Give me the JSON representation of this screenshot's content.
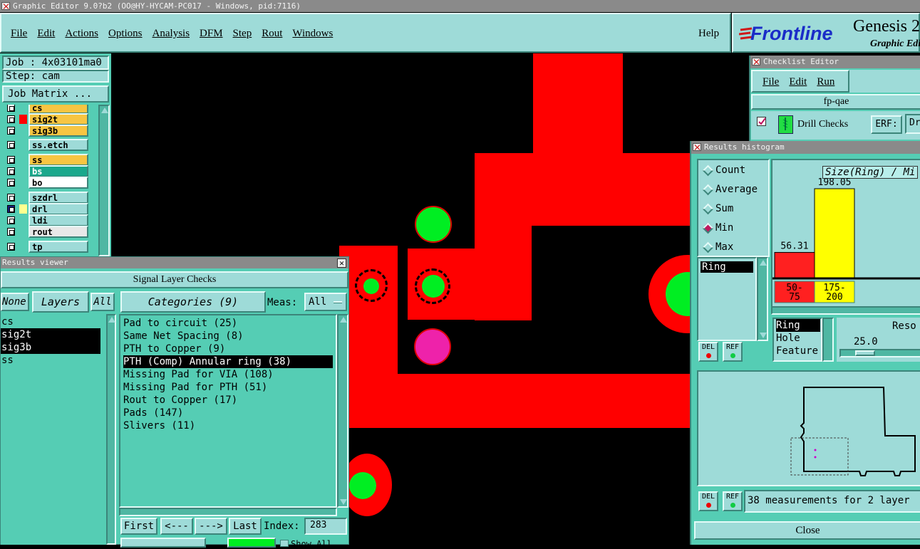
{
  "window_title": "Graphic Editor 9.0?b2 (OO@HY-HYCAM-PC017 - Windows, pid:7116)",
  "menu": [
    "File",
    "Edit",
    "Actions",
    "Options",
    "Analysis",
    "DFM",
    "Step",
    "Rout",
    "Windows"
  ],
  "help": "Help",
  "brand": {
    "logo": "Frontline",
    "product": "Genesis 2",
    "subtitle": "Graphic Edit"
  },
  "job": {
    "job_label": "Job : 4x03101ma0",
    "step_label": "Step: cam",
    "matrix_button": "Job Matrix ..."
  },
  "layers": [
    {
      "name": "cs",
      "color": "#f7c542"
    },
    {
      "name": "sig2t",
      "color": "#f7c542"
    },
    {
      "name": "sig3b",
      "color": "#f7c542"
    },
    {
      "name": "ss.etch",
      "color": "#9edbd8"
    },
    {
      "name": "ss",
      "color": "#f7c542"
    },
    {
      "name": "bs",
      "color": "#1aa88c"
    },
    {
      "name": "bo",
      "color": "#ffffff"
    },
    {
      "name": "szdrl",
      "color": "#9edbd8"
    },
    {
      "name": "drl",
      "color": "#9edbd8"
    },
    {
      "name": "ldi",
      "color": "#9edbd8"
    },
    {
      "name": "rout",
      "color": "#e8e8e8"
    },
    {
      "name": "tp",
      "color": "#9edbd8"
    }
  ],
  "results_viewer": {
    "title": "Results viewer",
    "header": "Signal Layer Checks",
    "none_btn": "None",
    "layers_btn": "Layers",
    "all_btn": "All",
    "categories_btn": "Categories (9)",
    "meas_label": "Meas:",
    "meas_value": "All",
    "layer_list": [
      "cs",
      "sig2t",
      "sig3b",
      "ss"
    ],
    "categories": [
      "Pad to circuit (25)",
      "Same Net Spacing (8)",
      "PTH to Copper (9)",
      "PTH (Comp) Annular ring (38)",
      "Missing Pad for VIA (108)",
      "Missing Pad for PTH (51)",
      "Rout to Copper (17)",
      "Pads (147)",
      "Slivers (11)"
    ],
    "selected_category": 3,
    "nav": {
      "first": "First",
      "prev": "<---",
      "next": "--->",
      "last": "Last",
      "index_label": "Index:",
      "index_value": "283"
    },
    "show_all": "Show All"
  },
  "checklist": {
    "title": "Checklist Editor",
    "menu": [
      "File",
      "Edit",
      "Run"
    ],
    "name": "fp-qae",
    "item": "Drill Checks",
    "erf_label": "ERF:",
    "erf_value": "Dr"
  },
  "histogram": {
    "title": "Results histogram",
    "modes": [
      "Count",
      "Average",
      "Sum",
      "Min",
      "Max"
    ],
    "selected_mode": "Min",
    "measure_list": [
      "Ring"
    ],
    "chart_title": "Size(Ring) / Mi",
    "del": "DEL",
    "ref": "REF",
    "attrs": [
      "Ring",
      "Hole",
      "Feature"
    ],
    "reso_label": "Reso",
    "reso_value": "25.0",
    "status": "38 measurements for 2 layer",
    "close": "Close",
    "chart_data": {
      "type": "bar",
      "categories": [
        "50-\n75",
        "175-\n200"
      ],
      "values": [
        56.31,
        198.05
      ],
      "value_labels": [
        "56.31",
        "198.05"
      ],
      "colors": [
        "#ff2020",
        "#ffff00"
      ]
    }
  }
}
